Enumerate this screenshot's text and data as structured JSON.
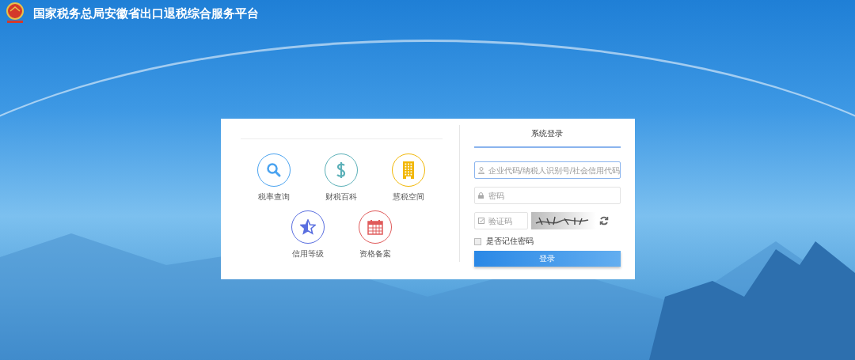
{
  "header": {
    "title": "国家税务总局安徽省出口退税综合服务平台"
  },
  "services": [
    {
      "label": "税率查询",
      "kind": "search",
      "color": "#4aa3f0"
    },
    {
      "label": "财税百科",
      "kind": "dollar",
      "color": "#5bb0b8"
    },
    {
      "label": "慧税空间",
      "kind": "building",
      "color": "#f2b705"
    },
    {
      "label": "信用等级",
      "kind": "star",
      "color": "#5a6fe0"
    },
    {
      "label": "资格备案",
      "kind": "calendar",
      "color": "#e05a5a"
    }
  ],
  "login": {
    "title": "系统登录",
    "fields": [
      {
        "kind": "user",
        "placeholder": "企业代码/纳税人识别号/社会信用代码",
        "focused": true
      },
      {
        "kind": "lock",
        "placeholder": "密码",
        "focused": false
      },
      {
        "kind": "captcha",
        "placeholder": "验证码",
        "focused": false
      }
    ],
    "remember": {
      "label": "是否记住密码",
      "checked": false
    },
    "button": "登录"
  }
}
